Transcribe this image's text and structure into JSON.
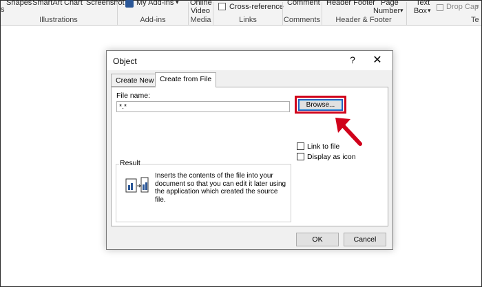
{
  "ribbon": {
    "top_items": {
      "s": "s",
      "shapes": "Shapes",
      "smartart": "SmartArt",
      "chart": "Chart",
      "screenshot": "Screenshot",
      "myaddins": "My Add-ins",
      "myaddins_arrow": "▾",
      "online": "Online",
      "video": "Video",
      "crossref": "Cross-reference",
      "comment": "Comment",
      "headerfooter": "Header  Footer",
      "page": "Page",
      "number": "Number",
      "number_arrow": "▾",
      "text": "Text",
      "box": "Box",
      "box_arrow": "▾",
      "dropcap": "Drop Cap",
      "dropcap_arrow": "▾"
    },
    "groups": {
      "illustrations": "Illustrations",
      "addins": "Add-ins",
      "media": "Media",
      "links": "Links",
      "comments": "Comments",
      "header_footer": "Header & Footer",
      "te": "Te"
    }
  },
  "dialog": {
    "title": "Object",
    "help": "?",
    "close": "✕",
    "tabs": [
      "Create New",
      "Create from File"
    ],
    "file_name_label": "File name:",
    "file_name_value": "*.*",
    "browse": "Browse...",
    "link_to_file": "Link to file",
    "display_as_icon": "Display as icon",
    "result_title": "Result",
    "result_text": "Inserts the contents of the file into your document so that you can edit it later using the application which created the source file.",
    "ok": "OK",
    "cancel": "Cancel"
  },
  "colors": {
    "highlight": "#d0021b",
    "focus": "#0078d7"
  }
}
